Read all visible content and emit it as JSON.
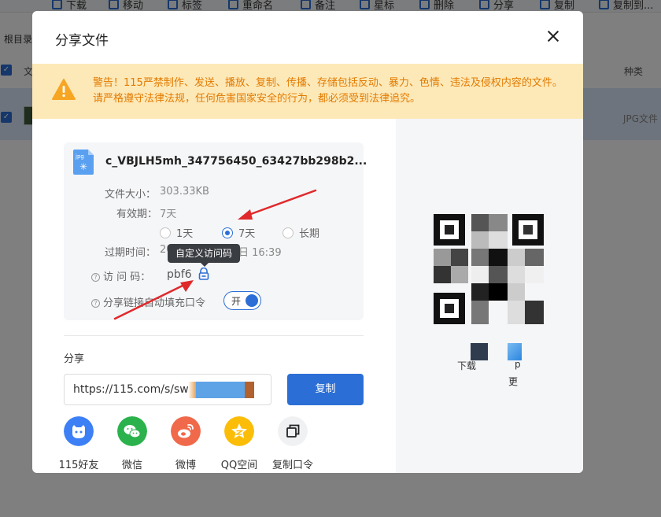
{
  "background": {
    "toolbar": [
      "下载",
      "移动",
      "标签",
      "重命名",
      "备注",
      "星标",
      "删除",
      "分享",
      "复制",
      "复制到..."
    ],
    "breadcrumb": "根目录",
    "column_file": "文",
    "column_type": "种类",
    "row_type": "JPG文件"
  },
  "dialog": {
    "title": "分享文件",
    "warning": "警告！115严禁制作、发送、播放、复制、传播、存储包括反动、暴力、色情、违法及侵权内容的文件。请严格遵守法律法规，任何危害国家安全的行为，都必须受到法律追究。",
    "file": {
      "name": "c_VBJLH5mh_347756450_63427bb298b2...",
      "icon_label": "jpg",
      "size_label": "文件大小：",
      "size": "303.33KB",
      "validity_label": "有效期：",
      "validity": "7天",
      "options": [
        "1天",
        "7天",
        "长期"
      ],
      "selected_option": "7天",
      "expire_label": "过期时间：",
      "expire_prefix": "20",
      "expire_suffix": "日 16:39",
      "tooltip": "自定义访问码",
      "code_label": "访 问 码：",
      "code": "pbf6",
      "autofill_label": "分享链接自动填充口令",
      "toggle_text": "开"
    },
    "share": {
      "label": "分享",
      "url": "https://115.com/s/sw6",
      "copy_button": "复制",
      "targets": [
        "115好友",
        "微信",
        "微博",
        "QQ空间",
        "复制口令"
      ]
    },
    "qr": {
      "caption_left": "下载",
      "caption_right_1": "p",
      "caption_right_2": "更"
    }
  },
  "colors": {
    "accent": "#2b6fd6",
    "warning_bg": "#fde9b8",
    "warning_text": "#e27a00",
    "annotation_arrow": "#e0292b",
    "friend": "#3d7ff5",
    "wechat": "#2bb24c",
    "weibo": "#f0694a",
    "qzone": "#fbbd08",
    "copy_cmd": "#f0f1f3"
  }
}
